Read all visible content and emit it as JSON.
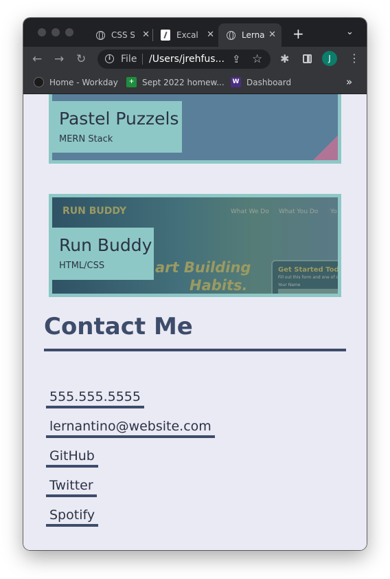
{
  "browser": {
    "tabs": [
      {
        "title": "CSS S",
        "active": false
      },
      {
        "title": "Excal",
        "active": false
      },
      {
        "title": "Lerna",
        "active": true
      }
    ],
    "address": {
      "scheme_label": "File",
      "url": "/Users/jrehfus..."
    },
    "profile_initial": "J",
    "bookmarks": [
      {
        "label": "Home - Workday",
        "icon": "workday-icon"
      },
      {
        "label": "Sept 2022 homew...",
        "icon": "sheets-icon"
      },
      {
        "label": "Dashboard",
        "icon": "uw-icon"
      }
    ]
  },
  "projects": [
    {
      "title": "Pastel Puzzels",
      "tech": "MERN Stack"
    },
    {
      "title": "Run Buddy",
      "tech": "HTML/CSS",
      "screenshot": {
        "logo": "RUN BUDDY",
        "nav": [
          "What We Do",
          "What You Do",
          "Yo"
        ],
        "slogan_1": "art Building",
        "slogan_2": "Habits.",
        "form_title": "Get Started Today",
        "form_subtitle": "Fill out this form and one of o",
        "form_label": "Your Name"
      }
    }
  ],
  "contact": {
    "heading": "Contact Me",
    "items": [
      "555.555.5555",
      "lernantino@website.com",
      "GitHub",
      "Twitter",
      "Spotify"
    ]
  },
  "colors": {
    "background": "#eaeaf4",
    "accent_teal": "#8dc8c6",
    "heading_navy": "#3e4c6b",
    "browser_chrome": "#35363a"
  }
}
